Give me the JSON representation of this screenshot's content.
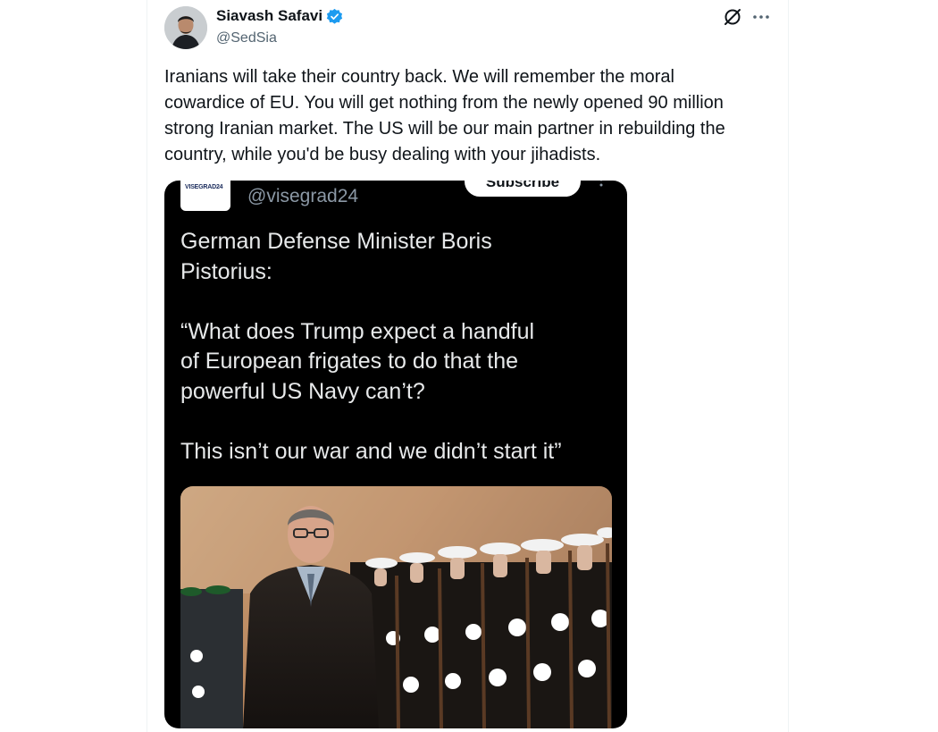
{
  "tweet": {
    "author_name": "Siavash Safavi",
    "author_handle": "@SedSia",
    "text": "Iranians will take their country back. We will remember the moral\ncowardice of EU. You will get nothing from the newly opened 90 million\nstrong Iranian market. The US will be our main partner in rebuilding the\ncountry, while you'd be busy dealing with your jihadists."
  },
  "icons": {
    "verified": "verified-badge-icon",
    "grok": "grok-icon",
    "more": "more-icon"
  },
  "embedded": {
    "logo_text": "VISEGRAD24",
    "handle": "@visegrad24",
    "subscribe_label": "Subscribe",
    "text": "German Defense Minister Boris\nPistorius:\n\n“What does Trump expect a handful\nof European frigates to do that the\npowerful US Navy can’t?\n\nThis isn’t our war and we didn’t start it”"
  },
  "colors": {
    "verified_blue": "#1d9bf0",
    "text_primary": "#0f1419",
    "text_secondary": "#536471",
    "embed_background": "#000000"
  }
}
